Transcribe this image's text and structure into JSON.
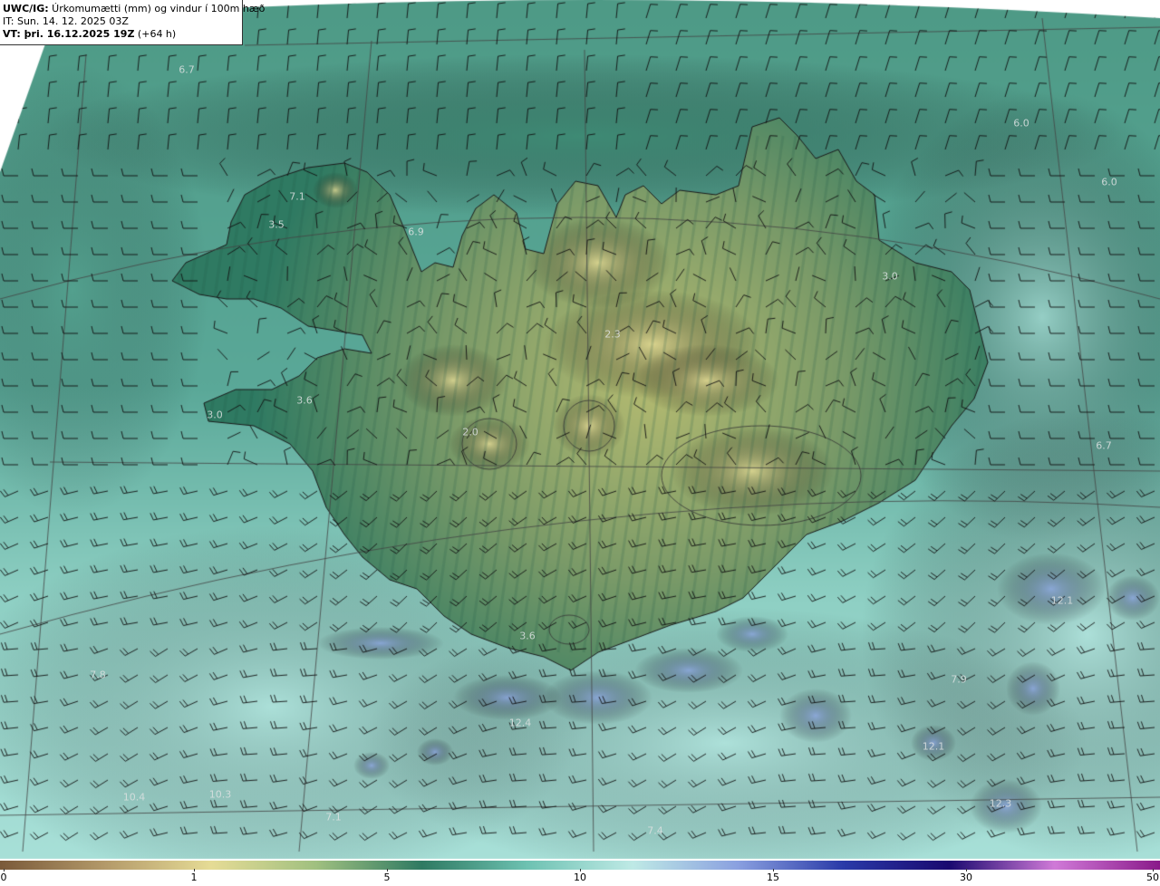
{
  "header": {
    "model_prefix": "UWC/IG:",
    "title_text": " Úrkomumætti (mm) og vindur í 100m hæð",
    "init_line": "IT: Sun. 14. 12. 2025 03Z",
    "valid_prefix": "VT:",
    "valid_text": " þri. 16.12.2025 19Z",
    "valid_suffix": " (+64 h)"
  },
  "colorbar": {
    "ticks": [
      {
        "label": "0",
        "value": 0
      },
      {
        "label": "1",
        "value": 1
      },
      {
        "label": "5",
        "value": 5
      },
      {
        "label": "10",
        "value": 10
      },
      {
        "label": "15",
        "value": 15
      },
      {
        "label": "30",
        "value": 30
      },
      {
        "label": "50",
        "value": 50
      }
    ],
    "colors": [
      "#7a5a3a",
      "#b49a6a",
      "#e6dc96",
      "#a0c080",
      "#2f7a62",
      "#6ec2b2",
      "#bfeae6",
      "#8aa0e0",
      "#2a3aa8",
      "#1a0a70",
      "#d07ad8",
      "#8a1a8a"
    ]
  },
  "map_values": [
    {
      "text": "6.7"
    },
    {
      "text": "6.0"
    },
    {
      "text": "6.0"
    },
    {
      "text": "7.1"
    },
    {
      "text": "3.5"
    },
    {
      "text": "6.9"
    },
    {
      "text": "3.0"
    },
    {
      "text": "2.3"
    },
    {
      "text": "3.6"
    },
    {
      "text": "3.0"
    },
    {
      "text": "2.0"
    },
    {
      "text": "6.7"
    },
    {
      "text": "3.6"
    },
    {
      "text": "7.8"
    },
    {
      "text": "12.1"
    },
    {
      "text": "7.9"
    },
    {
      "text": "12.4"
    },
    {
      "text": "12.1"
    },
    {
      "text": "10.4"
    },
    {
      "text": "10.3"
    },
    {
      "text": "7.1"
    },
    {
      "text": "7.4"
    },
    {
      "text": "12.3"
    }
  ],
  "style": {
    "land_low": "#2f7a62",
    "land_high": "#e6dc96",
    "sea_base": "#5aa898",
    "sea_light": "#bfeae6",
    "precip_high": "#8aa0e0"
  }
}
